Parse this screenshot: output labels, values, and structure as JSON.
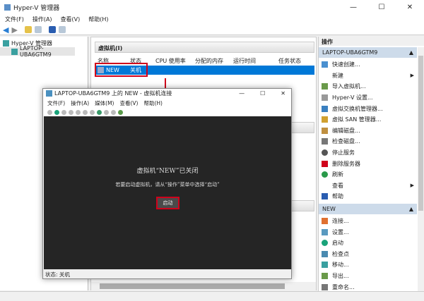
{
  "window": {
    "title": "Hyper-V 管理器",
    "min": "—",
    "max": "☐",
    "close": "✕"
  },
  "menu": [
    "文件(F)",
    "操作(A)",
    "查看(V)",
    "帮助(H)"
  ],
  "tree": {
    "root": "Hyper-V 管理器",
    "host": "LAPTOP-UBA6GTM9"
  },
  "vms": {
    "section": "虚拟机(I)",
    "columns": [
      "名称",
      "状态",
      "CPU 使用率",
      "分配的内存",
      "运行时间",
      "任务状态"
    ],
    "rows": [
      {
        "name": "NEW",
        "state": "关机"
      }
    ]
  },
  "actions": {
    "header": "操作",
    "host_group": "LAPTOP-UBA6GTM9",
    "host_items": [
      "快速创建...",
      "新建",
      "导入虚拟机...",
      "Hyper-V 设置...",
      "虚拟交换机管理器...",
      "虚拟 SAN 管理器...",
      "编辑磁盘...",
      "检查磁盘...",
      "停止服务",
      "删除服务器",
      "刷新",
      "查看",
      "帮助"
    ],
    "vm_group": "NEW",
    "vm_items": [
      "连接...",
      "设置...",
      "启动",
      "检查点",
      "移动...",
      "导出...",
      "重命名..."
    ]
  },
  "dialog": {
    "title": "LAPTOP-UBA6GTM9 上的 NEW - 虚拟机连接",
    "menu": [
      "文件(F)",
      "操作(A)",
      "媒体(M)",
      "查看(V)",
      "帮助(H)"
    ],
    "message": "虚拟机“NEW”已关闭",
    "hint": "若要启动虚拟机，请从“操作”菜单中选择“启动”",
    "start": "启动",
    "status": "状态: 关机",
    "min": "—",
    "max": "☐",
    "close": "✕"
  },
  "colors": {
    "accent": "#0078d7",
    "highlight": "#d0021b",
    "screen": "#252525"
  }
}
